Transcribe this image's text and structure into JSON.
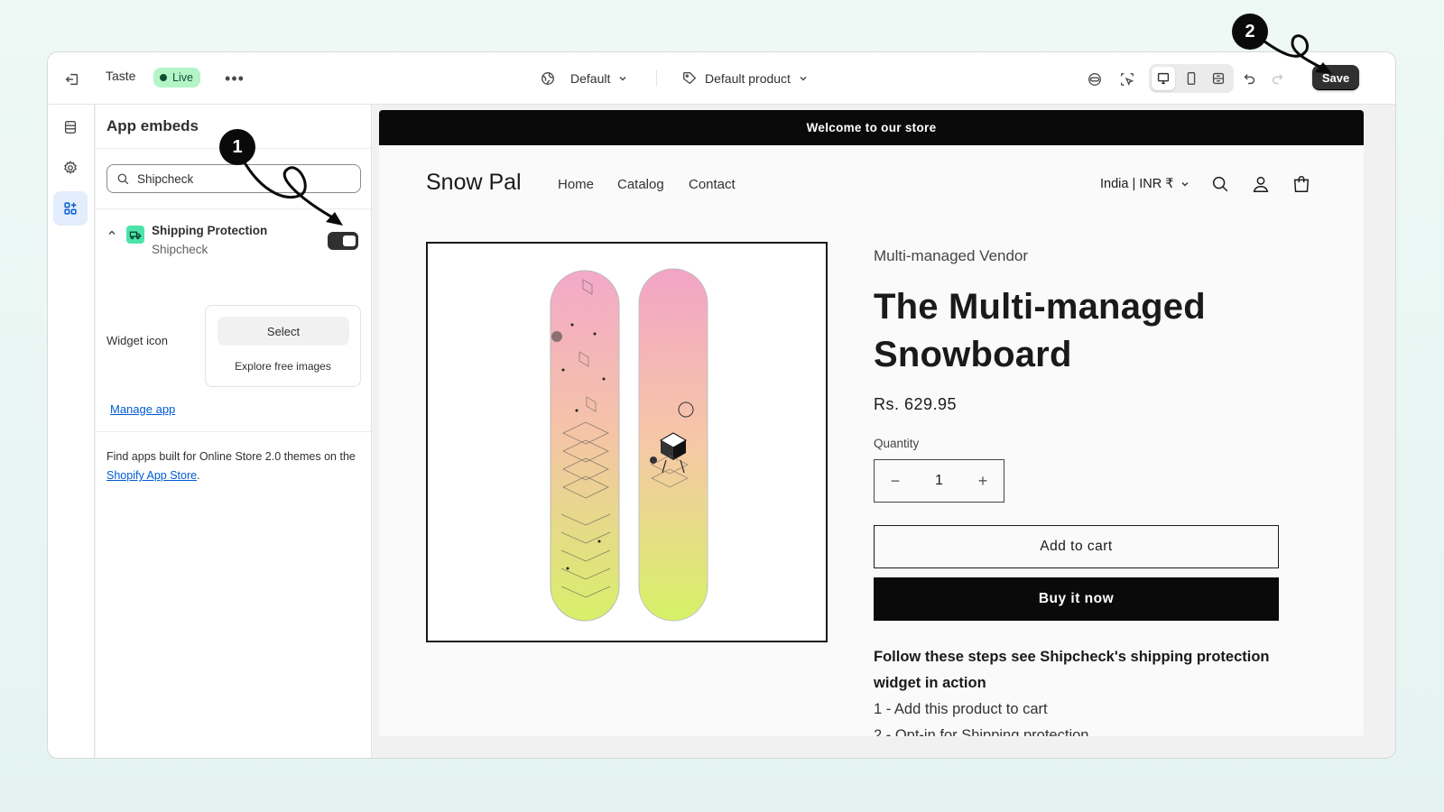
{
  "topbar": {
    "store_name": "Taste",
    "live_label": "Live",
    "theme_label": "Default",
    "product_label": "Default product",
    "save_label": "Save"
  },
  "sidebar": {
    "title": "App embeds",
    "search_value": "Shipcheck",
    "embed": {
      "name": "Shipping Protection",
      "app": "Shipcheck",
      "enabled": true
    },
    "widget_label": "Widget icon",
    "select_label": "Select",
    "explore_label": "Explore free images",
    "manage_label": "Manage app",
    "footer_text": "Find apps built for Online Store 2.0 themes on the ",
    "footer_link": "Shopify App Store",
    "footer_end": "."
  },
  "store": {
    "announcement": "Welcome to our store",
    "logo": "Snow Pal",
    "nav": [
      "Home",
      "Catalog",
      "Contact"
    ],
    "currency": "India | INR ₹"
  },
  "product": {
    "vendor": "Multi-managed Vendor",
    "title": "The Multi-managed Snowboard",
    "price": "Rs. 629.95",
    "quantity_label": "Quantity",
    "quantity": "1",
    "minus": "−",
    "plus": "+",
    "add_to_cart": "Add to cart",
    "buy_now": "Buy it now",
    "desc_heading": "Follow these steps see Shipcheck's shipping protection widget in action",
    "steps": [
      "1 - Add this product to cart",
      "2 - Opt-in for Shipping protection"
    ]
  },
  "annotations": [
    "1",
    "2"
  ],
  "colors": {
    "accent": "#303030",
    "live": "#b4f5c8",
    "link": "#005bd3",
    "app_icon": "#4be3a9"
  }
}
